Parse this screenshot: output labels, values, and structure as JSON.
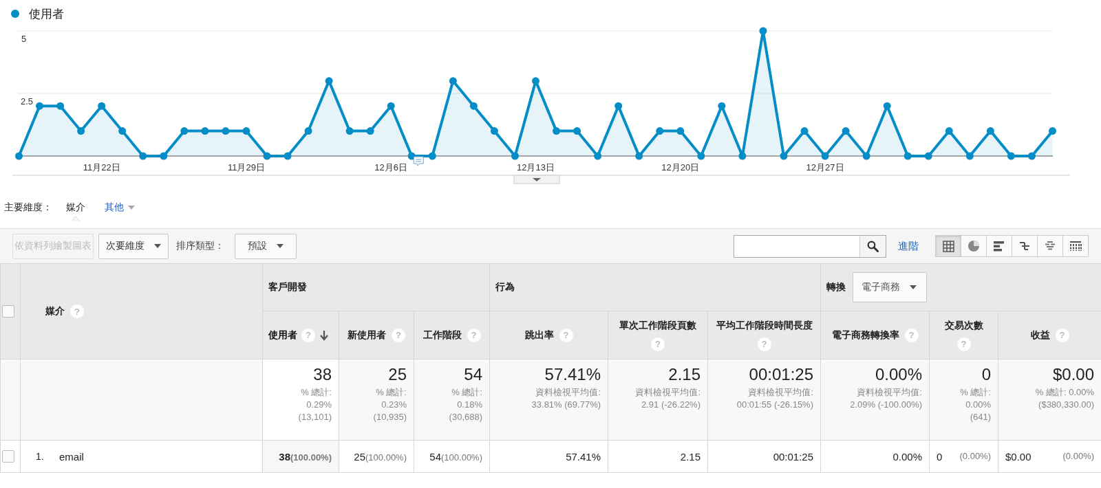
{
  "chart": {
    "chart_data": {
      "type": "area",
      "ylim": [
        0,
        5
      ],
      "yticks": [
        {
          "value": 2.5,
          "label": "2.5"
        },
        {
          "value": 5,
          "label": "5"
        }
      ],
      "categories": [
        null,
        null,
        null,
        null,
        "11月22日",
        null,
        null,
        null,
        null,
        null,
        null,
        "11月29日",
        null,
        null,
        null,
        null,
        null,
        null,
        "12月6日",
        null,
        null,
        null,
        null,
        null,
        null,
        "12月13日",
        null,
        null,
        null,
        null,
        null,
        null,
        "12月20日",
        null,
        null,
        null,
        null,
        null,
        null,
        "12月27日",
        null,
        null,
        null,
        null,
        null,
        null,
        null,
        null,
        null,
        null,
        null
      ],
      "series": [
        {
          "name": "使用者",
          "color": "#058dc7",
          "values": [
            0,
            2,
            2,
            1,
            2,
            1,
            0,
            0,
            1,
            1,
            1,
            1,
            0,
            0,
            1,
            3,
            1,
            1,
            2,
            0,
            0,
            3,
            2,
            1,
            0,
            3,
            1,
            1,
            0,
            2,
            0,
            1,
            1,
            0,
            2,
            0,
            5,
            0,
            1,
            0,
            1,
            0,
            2,
            0,
            0,
            1,
            0,
            1,
            0,
            0,
            1
          ]
        }
      ]
    }
  },
  "dimension_bar": {
    "label": "主要維度：",
    "options": [
      {
        "label": "媒介",
        "selected": true
      },
      {
        "label": "其他",
        "selected": false
      }
    ]
  },
  "toolbar": {
    "plot_button": {
      "label": "依資料列繪製圖表",
      "disabled": true
    },
    "secondary_dimension": "次要維度",
    "sort_label": "排序類型：",
    "sort_value": "預設",
    "advanced_link": "進階",
    "view_buttons": [
      {
        "kind": "table",
        "selected": true
      },
      {
        "kind": "pie",
        "selected": false
      },
      {
        "kind": "bar",
        "selected": false
      },
      {
        "kind": "compare",
        "selected": false
      },
      {
        "kind": "cloud",
        "selected": false
      },
      {
        "kind": "pivot",
        "selected": false
      }
    ]
  },
  "table": {
    "select_all": {
      "checked": false
    },
    "dimension_header": {
      "label": "媒介",
      "help": "?"
    },
    "groups": [
      {
        "label": "客戶開發"
      },
      {
        "label": "行為"
      },
      {
        "label": "轉換",
        "dropdown": "電子商務"
      }
    ],
    "columns": [
      {
        "label": "使用者",
        "help": "?",
        "sorted": true
      },
      {
        "label": "新使用者",
        "help": "?",
        "sorted": false
      },
      {
        "label": "工作階段",
        "help": "?",
        "sorted": false
      },
      {
        "label": "跳出率",
        "help": "?",
        "sorted": false
      },
      {
        "label": "單次工作階段頁數",
        "help": "?",
        "sorted": false
      },
      {
        "label": "平均工作階段時間長度",
        "help": "?",
        "sorted": false
      },
      {
        "label": "電子商務轉換率",
        "help": "?",
        "sorted": false
      },
      {
        "label": "交易次數",
        "help": "?",
        "sorted": false
      },
      {
        "label": "收益",
        "help": "?",
        "sorted": false
      }
    ],
    "totals": [
      {
        "value": "38",
        "lines": [
          "% 總計:",
          "0.29%",
          "(13,101)"
        ]
      },
      {
        "value": "25",
        "lines": [
          "% 總計:",
          "0.23%",
          "(10,935)"
        ]
      },
      {
        "value": "54",
        "lines": [
          "% 總計:",
          "0.18%",
          "(30,688)"
        ]
      },
      {
        "value": "57.41%",
        "lines": [
          "資料檢視平均值:",
          "33.81% (69.77%)"
        ]
      },
      {
        "value": "2.15",
        "lines": [
          "資料檢視平均值:",
          "2.91 (-26.22%)"
        ]
      },
      {
        "value": "00:01:25",
        "lines": [
          "資料檢視平均值:",
          "00:01:55 (-26.15%)"
        ]
      },
      {
        "value": "0.00%",
        "lines": [
          "資料檢視平均值:",
          "2.09% (-100.00%)"
        ]
      },
      {
        "value": "0",
        "lines": [
          "% 總計:",
          "0.00%",
          "(641)"
        ]
      },
      {
        "value": "$0.00",
        "lines": [
          "% 總計: 0.00%",
          "($380,330.00)"
        ]
      }
    ],
    "rows": [
      {
        "index": "1.",
        "name": "email",
        "checked": false,
        "cells": [
          {
            "kind": "inline",
            "value": "38",
            "share": "(100.00%)"
          },
          {
            "kind": "inline",
            "value": "25",
            "share": "(100.00%)"
          },
          {
            "kind": "inline",
            "value": "54",
            "share": "(100.00%)"
          },
          {
            "kind": "plain",
            "value": "57.41%"
          },
          {
            "kind": "plain",
            "value": "2.15"
          },
          {
            "kind": "plain",
            "value": "00:01:25"
          },
          {
            "kind": "plain",
            "value": "0.00%"
          },
          {
            "kind": "split",
            "value": "0",
            "share": "(0.00%)"
          },
          {
            "kind": "split",
            "value": "$0.00",
            "share": "(0.00%)"
          }
        ]
      }
    ]
  }
}
